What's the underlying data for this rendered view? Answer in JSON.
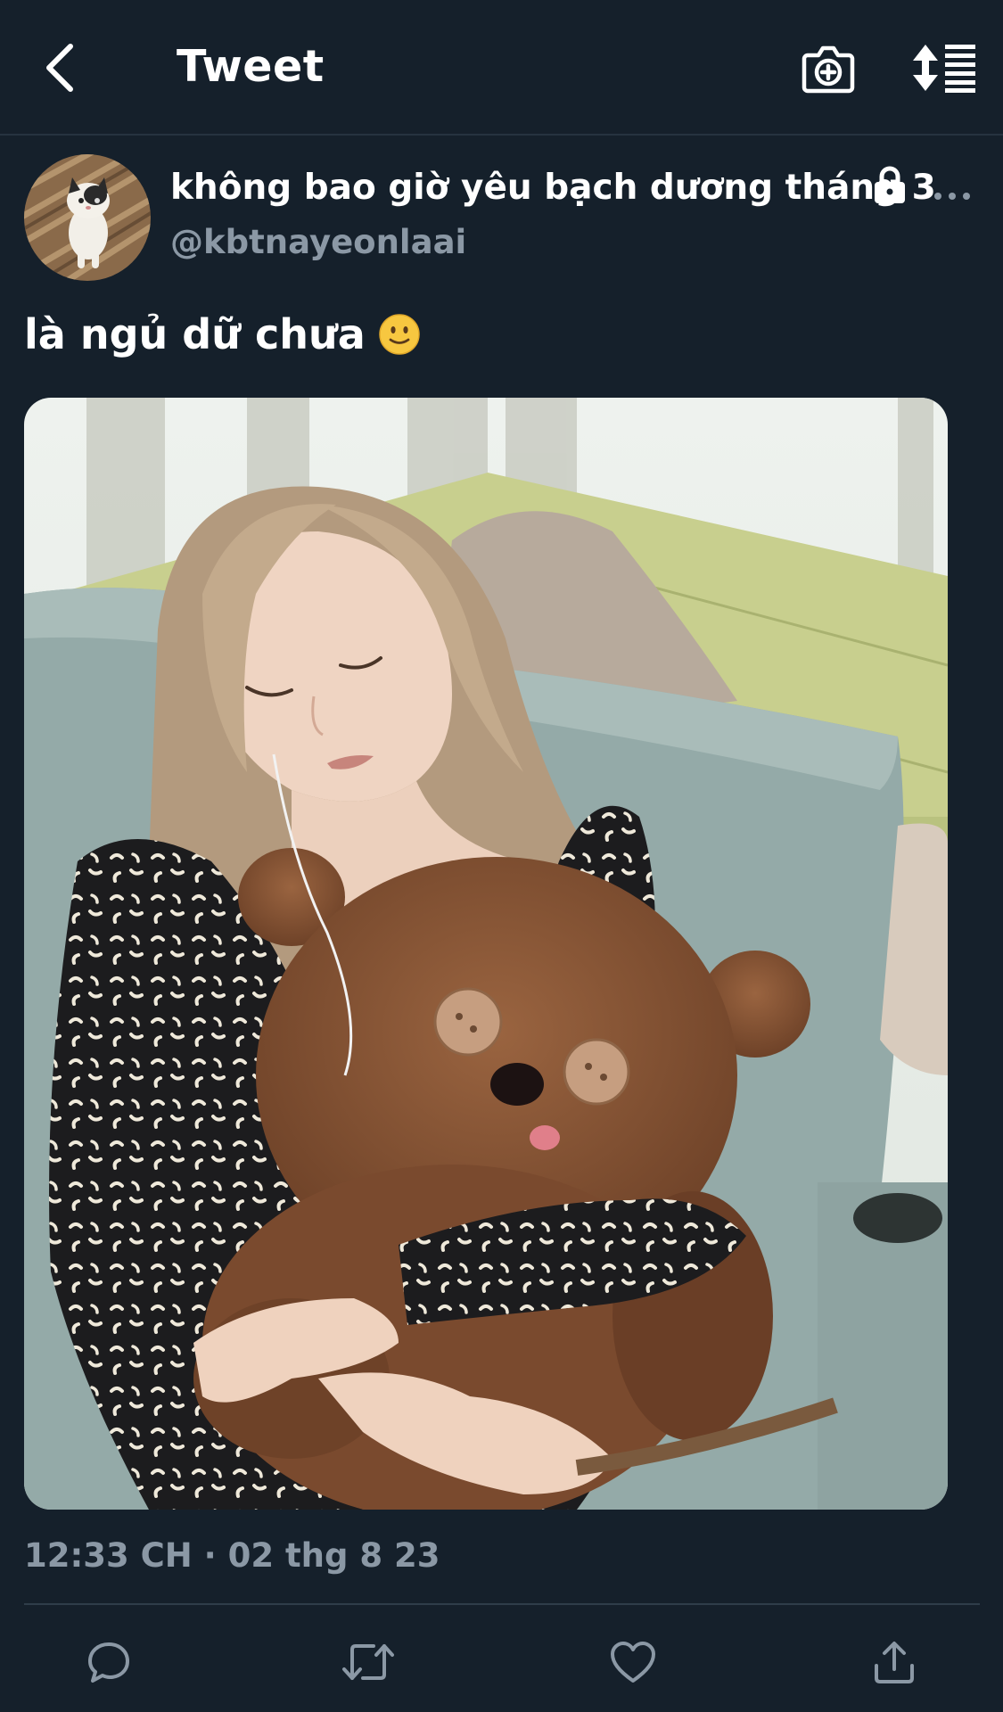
{
  "header": {
    "title": "Tweet",
    "back_icon": "chevron-left-icon",
    "camera_icon": "camera-add-icon",
    "sort_icon": "sort-replies-icon"
  },
  "author": {
    "display_name": "không bao giờ yêu bạch dương tháng 3",
    "handle": "@kbtnayeonlaai",
    "protected_icon": "lock-icon",
    "more_icon": "more-horizontal-icon"
  },
  "tweet": {
    "text": "là ngủ dữ chưa",
    "emoji_icon": "slightly-smiling-face-icon",
    "timestamp": "12:33 CH · 02 thg 8 23"
  },
  "actions": [
    {
      "name": "reply",
      "icon": "reply-icon"
    },
    {
      "name": "retweet",
      "icon": "retweet-icon"
    },
    {
      "name": "like",
      "icon": "heart-icon"
    },
    {
      "name": "share",
      "icon": "share-icon"
    }
  ],
  "colors": {
    "background": "#15202b",
    "text_primary": "#ffffff",
    "text_secondary": "#8b98a5",
    "divider": "#2f3d4a"
  }
}
